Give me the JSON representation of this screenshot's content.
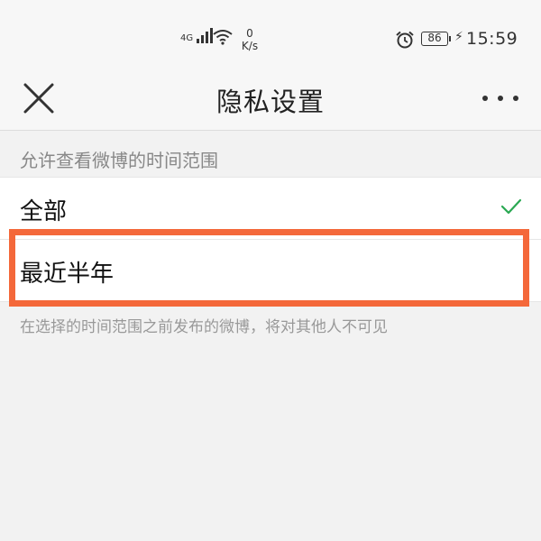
{
  "status_bar": {
    "network_type": "4G",
    "net_speed_value": "0",
    "net_speed_unit": "K/s",
    "battery_level": "86",
    "time": "15:59"
  },
  "nav": {
    "title": "隐私设置",
    "close_icon": "close-icon",
    "more_icon": "more-icon"
  },
  "section": {
    "header": "允许查看微博的时间范围"
  },
  "options": [
    {
      "label": "全部",
      "selected": true
    },
    {
      "label": "最近半年",
      "selected": false
    }
  ],
  "footnote": "在选择的时间范围之前发布的微博，将对其他人不可见",
  "colors": {
    "highlight_border": "#f4683a",
    "checkmark": "#2aa852"
  }
}
